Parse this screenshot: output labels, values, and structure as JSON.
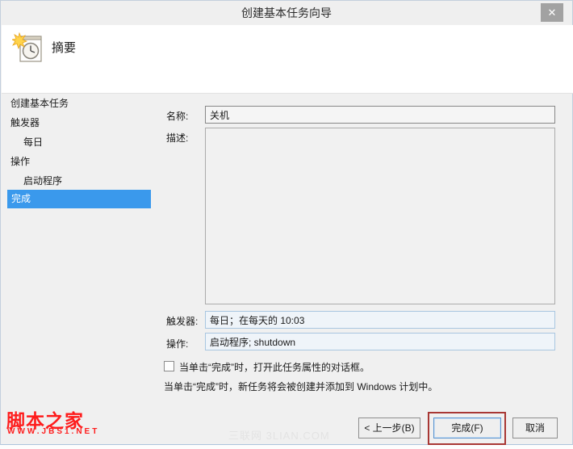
{
  "window": {
    "title": "创建基本任务向导",
    "close_glyph": "✕"
  },
  "header": {
    "title": "摘要"
  },
  "sidebar": {
    "items": [
      {
        "label": "创建基本任务"
      },
      {
        "label": "触发器"
      },
      {
        "label": "每日"
      },
      {
        "label": "操作"
      },
      {
        "label": "启动程序"
      },
      {
        "label": "完成"
      }
    ]
  },
  "form": {
    "name_label": "名称:",
    "name_value": "关机",
    "description_label": "描述:",
    "description_value": "",
    "trigger_label": "触发器:",
    "trigger_value": "每日；在每天的 10:03",
    "action_label": "操作:",
    "action_value": "启动程序; shutdown",
    "open_properties_checkbox_label": "当单击“完成”时，打开此任务属性的对话框。",
    "finish_note": "当单击“完成”时，新任务将会被创建并添加到 Windows 计划中。"
  },
  "buttons": {
    "back": "< 上一步(B)",
    "finish": "完成(F)",
    "cancel": "取消"
  },
  "watermarks": {
    "site_name": "脚本之家",
    "site_url": "WWW.JBS1.NET",
    "center": "三联网 3LIAN.COM"
  },
  "colors": {
    "sidebar_highlight": "#3a99ec",
    "annotation_red": "#a83734",
    "watermark_red": "#fe1c1c"
  }
}
